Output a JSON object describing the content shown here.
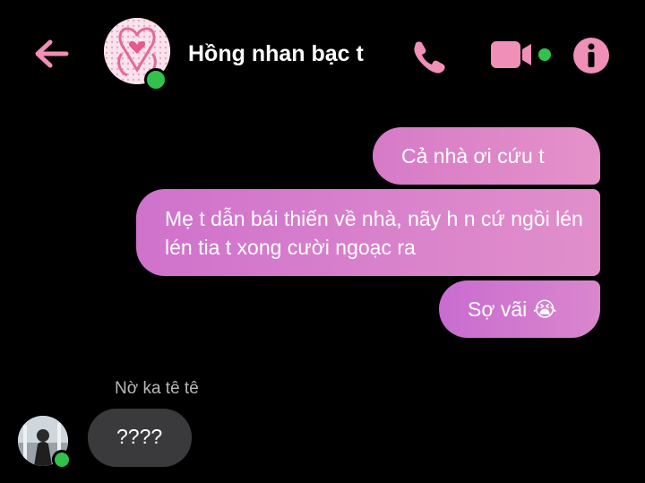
{
  "header": {
    "title": "Hồng nhan bạc t",
    "accent_color": "#f08fb8",
    "online_color": "#31c24b",
    "icons": [
      "back-arrow-icon",
      "group-avatar",
      "phone-icon",
      "video-camera-icon",
      "info-icon"
    ]
  },
  "messages_out": [
    {
      "text": "Cả nhà ơi cứu t"
    },
    {
      "text": "Mẹ t dẫn bái thiến về nhà, nãy h n cứ ngồi lén lén tia t xong cười ngoạc ra"
    },
    {
      "text": "Sợ vãi 😭"
    }
  ],
  "incoming": {
    "sender": "Nờ ka tê tê",
    "text": "????"
  },
  "colors": {
    "bubble_out_start": "#d67ac8",
    "bubble_out_end": "#e592c9",
    "bubble_in": "#3a3a3c",
    "background": "#000000"
  }
}
